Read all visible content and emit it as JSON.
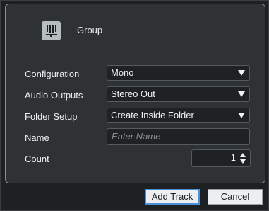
{
  "header": {
    "track_type": "Group",
    "icon": "group-track-icon"
  },
  "form": {
    "configuration": {
      "label": "Configuration",
      "value": "Mono"
    },
    "audio_outputs": {
      "label": "Audio Outputs",
      "value": "Stereo Out"
    },
    "folder_setup": {
      "label": "Folder Setup",
      "value": "Create Inside Folder"
    },
    "name": {
      "label": "Name",
      "placeholder": "Enter Name",
      "value": ""
    },
    "count": {
      "label": "Count",
      "value": "1"
    }
  },
  "buttons": {
    "add_track": "Add Track",
    "cancel": "Cancel"
  },
  "colors": {
    "focus_accent": "#4a90d9"
  }
}
